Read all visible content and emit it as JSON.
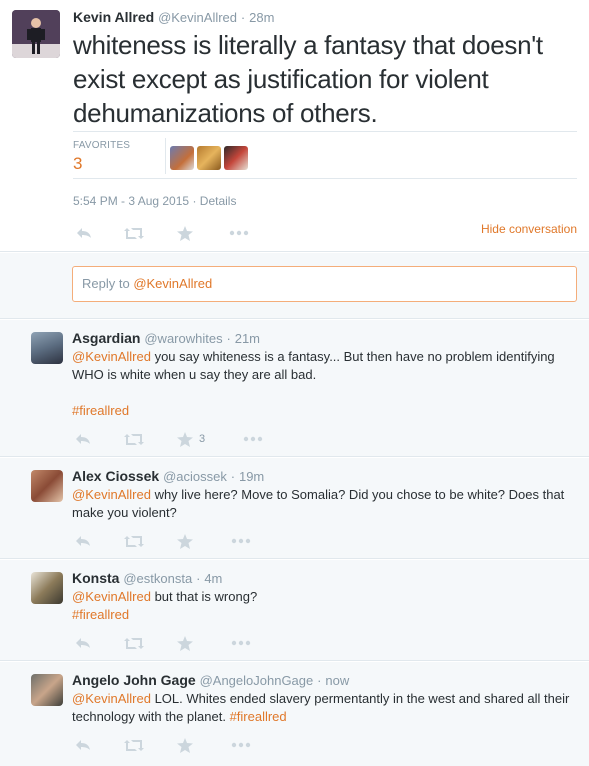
{
  "main_tweet": {
    "name": "Kevin Allred",
    "handle": "@KevinAllred",
    "sep": "·",
    "time": "28m",
    "text": "whiteness is literally a fantasy that doesn't exist except as justification for violent dehumanizations of others.",
    "favorites_label": "FAVORITES",
    "favorites_count": "3",
    "timestamp": "5:54 PM - 3 Aug 2015",
    "details_sep": "·",
    "details": "Details",
    "hide_conversation": "Hide conversation"
  },
  "reply_box": {
    "prefix": "Reply to ",
    "mention": "@KevinAllred"
  },
  "replies": [
    {
      "name": "Asgardian",
      "handle": "@warowhites",
      "sep": "·",
      "time": "21m",
      "mention": "@KevinAllred",
      "text": " you say whiteness is a fantasy... But then have no problem identifying WHO is white when u say they are all bad.",
      "hashtag": "#fireallred",
      "fav_count": "3"
    },
    {
      "name": "Alex Ciossek",
      "handle": "@aciossek",
      "sep": "·",
      "time": "19m",
      "mention": "@KevinAllred",
      "text": " why live here? Move to Somalia? Did you chose to be white? Does that make you violent?"
    },
    {
      "name": "Konsta",
      "handle": "@estkonsta",
      "sep": "·",
      "time": "4m",
      "mention": "@KevinAllred",
      "text": " but that is wrong?",
      "hashtag": "#fireallred"
    },
    {
      "name": "Angelo John Gage",
      "handle": "@AngeloJohnGage",
      "sep": "·",
      "time": "now",
      "mention": "@KevinAllred",
      "text": " LOL. Whites ended slavery permentantly in the west and shared all their technology with the planet. ",
      "hashtag": "#fireallred"
    }
  ],
  "icons": [
    "reply-icon",
    "retweet-icon",
    "favorite-icon",
    "more-icon"
  ],
  "colors": {
    "accent": "#e0782a",
    "muted": "#8899a6",
    "bg_conversation": "#f5f8fa"
  }
}
